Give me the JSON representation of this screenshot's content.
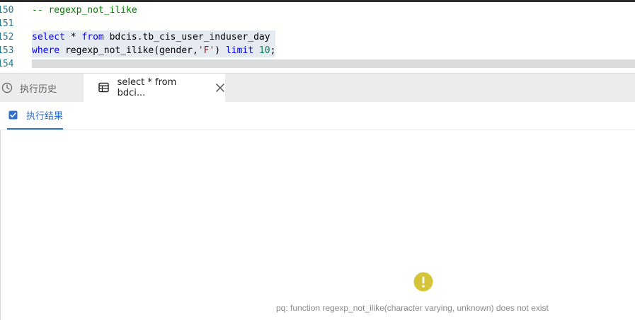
{
  "editor": {
    "lines": [
      {
        "number": "150",
        "comment": "-- regexp_not_ilike"
      },
      {
        "number": "151"
      },
      {
        "number": "152",
        "kw_select": "select",
        "star": "*",
        "kw_from": "from",
        "table": "bdcis.tb_cis_user_induser_day"
      },
      {
        "number": "153",
        "kw_where": "where",
        "func": "regexp_not_ilike(gender,",
        "string": "'F'",
        "close": ")",
        "kw_limit": "limit",
        "limit_value": "10",
        "semi": ";"
      },
      {
        "number": "154"
      }
    ]
  },
  "tabs": {
    "history": {
      "label": "执行历史",
      "icon": "clock-history-icon"
    },
    "query": {
      "label": "select * from bdci...",
      "icon": "table-icon",
      "close_icon": "close-icon"
    }
  },
  "result": {
    "subtab_label": "执行结果",
    "subtab_icon": "checkbox-icon",
    "error_icon": "warning-icon",
    "error_message": "pq: function regexp_not_ilike(character varying, unknown) does not exist"
  },
  "colors": {
    "accent": "#2f6fd1",
    "warning": "#d4c43a",
    "tabbar_bg": "#ebecee"
  }
}
